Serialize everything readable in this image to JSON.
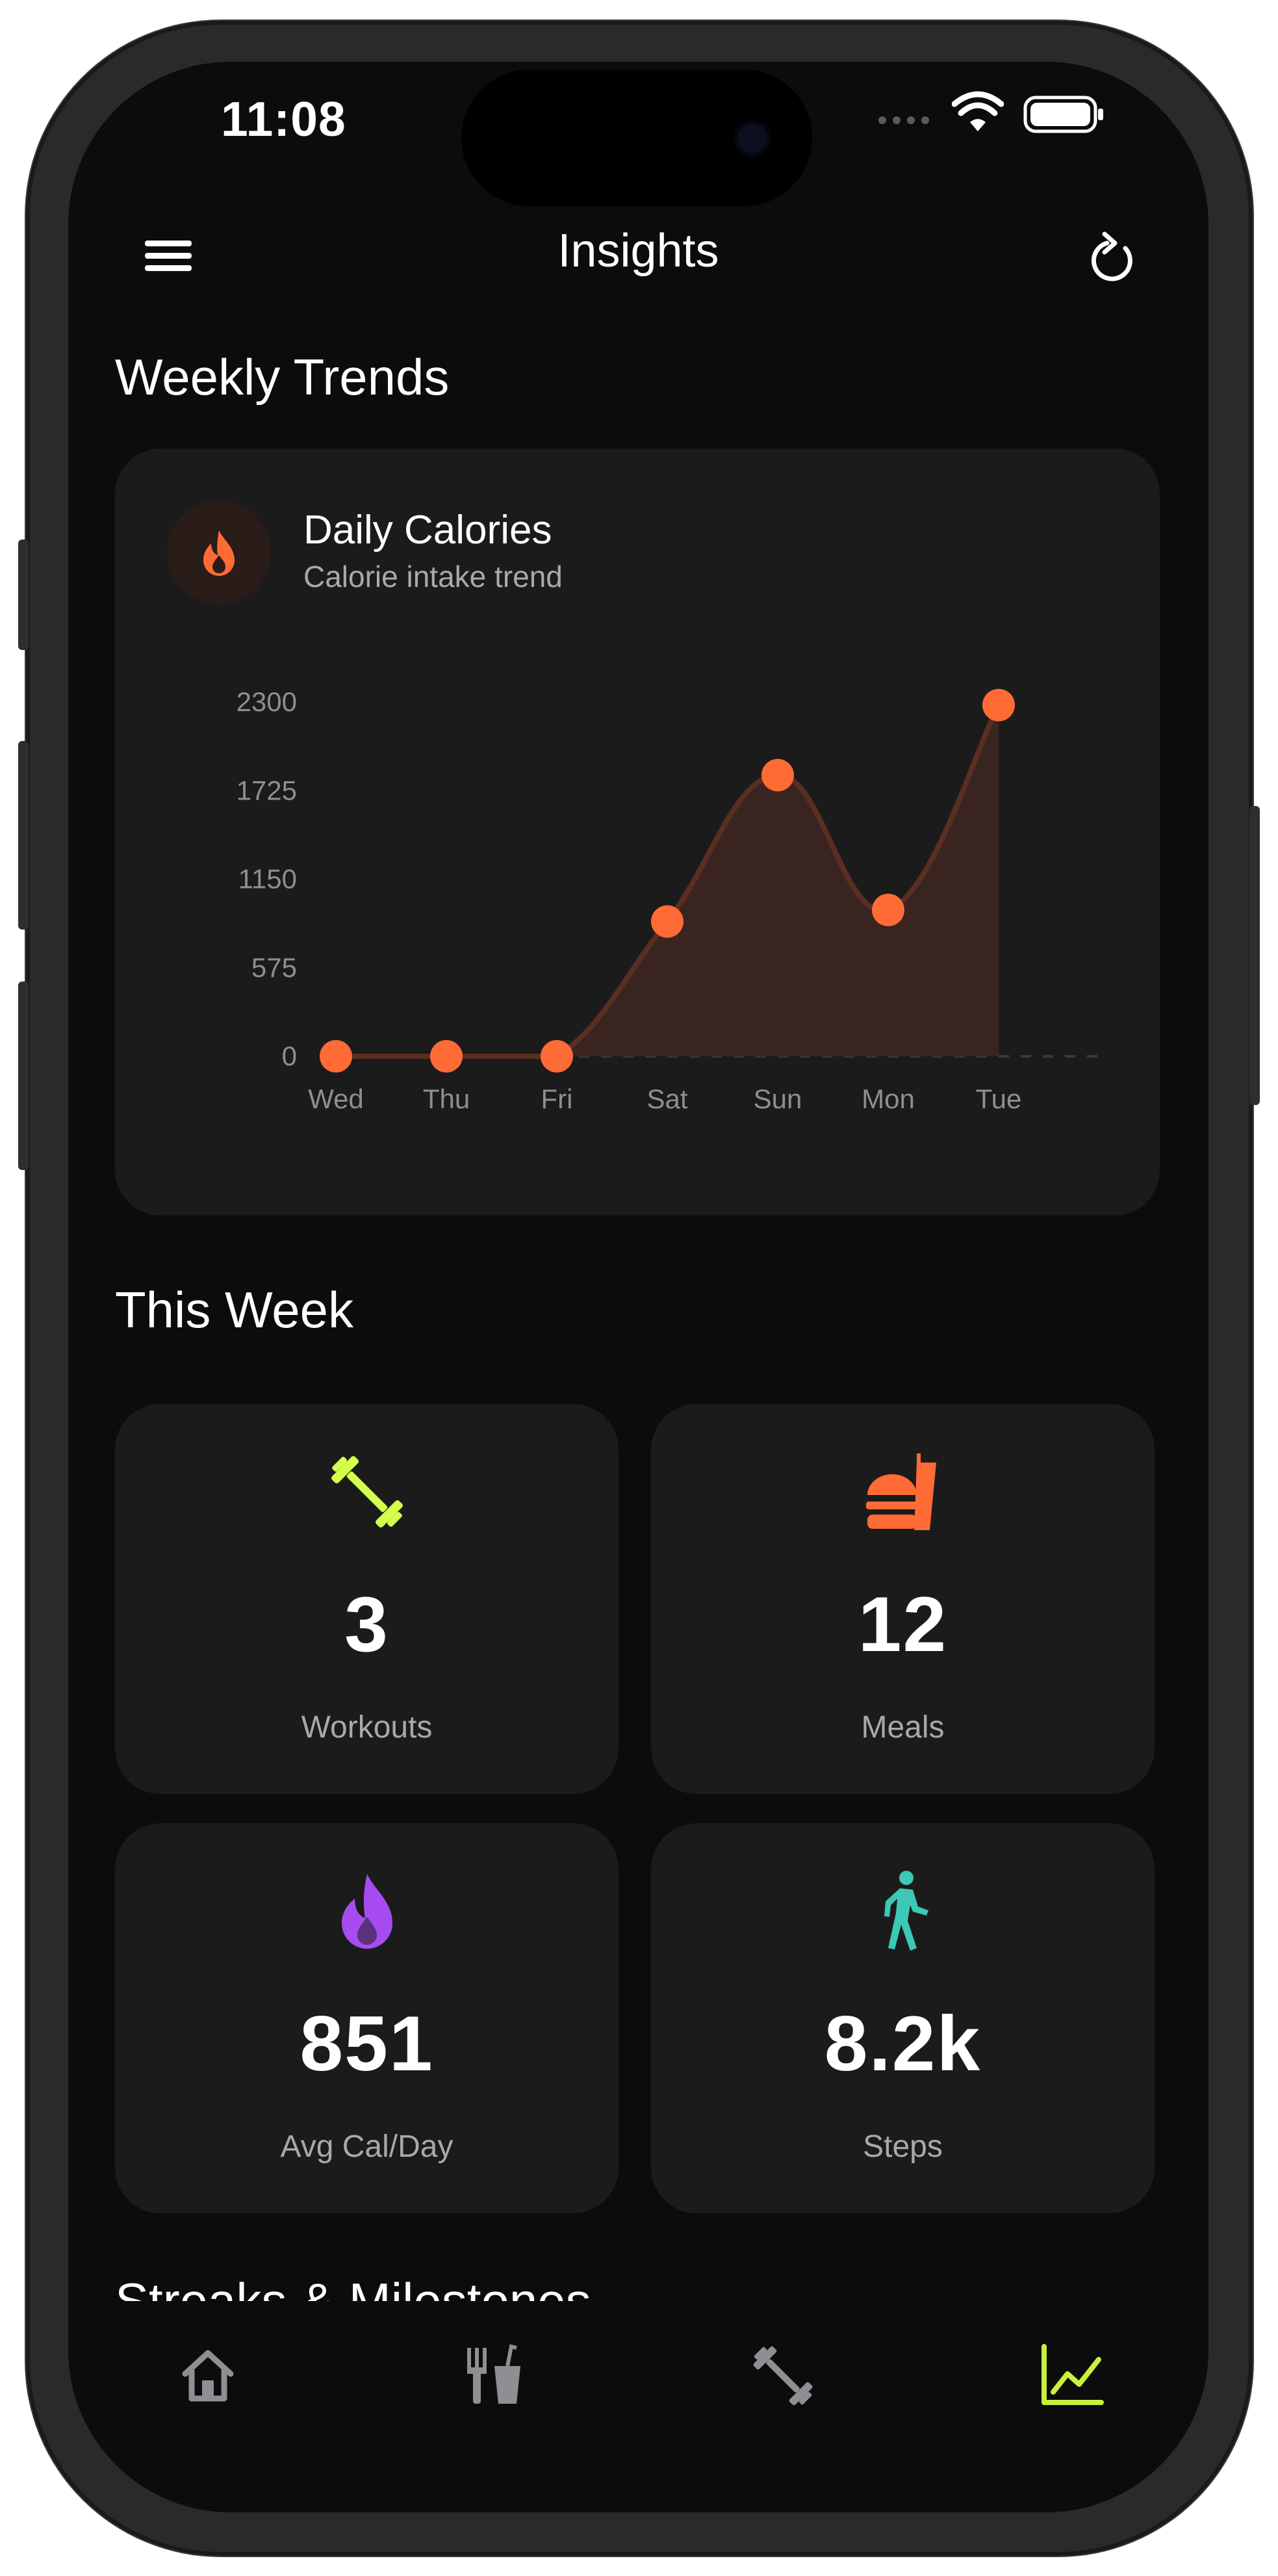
{
  "status_bar": {
    "time": "11:08"
  },
  "header": {
    "title": "Insights",
    "menu_icon": "hamburger-menu-icon",
    "refresh_icon": "refresh-icon"
  },
  "weekly_trends": {
    "section_title": "Weekly Trends",
    "card": {
      "icon": "flame-icon",
      "title": "Daily Calories",
      "subtitle": "Calorie intake trend"
    }
  },
  "chart_data": {
    "type": "area",
    "categories": [
      "Wed",
      "Thu",
      "Fri",
      "Sat",
      "Sun",
      "Mon",
      "Tue"
    ],
    "series": [
      {
        "values": [
          0,
          0,
          0,
          875,
          1825,
          950,
          2280
        ]
      }
    ],
    "yticks": [
      "2300",
      "1725",
      "1150",
      "575",
      "0"
    ],
    "ylim": [
      0,
      2300
    ],
    "grid": false,
    "colors": {
      "line": "#f26a3a",
      "fill": "#3a2420",
      "point": "#ff6b35"
    }
  },
  "this_week": {
    "section_title": "This Week",
    "stats": [
      {
        "value": "3",
        "label": "Workouts",
        "icon": "dumbbell-icon",
        "color": "#d4ff4a"
      },
      {
        "value": "12",
        "label": "Meals",
        "icon": "fast-food-icon",
        "color": "#ff6b35"
      },
      {
        "value": "851",
        "label": "Avg Cal/Day",
        "icon": "flame-icon",
        "color": "#a64cf0"
      },
      {
        "value": "8.2k",
        "label": "Steps",
        "icon": "walking-icon",
        "color": "#3cc8b4"
      }
    ]
  },
  "streaks": {
    "section_title": "Streaks & Milestones"
  },
  "tab_bar": {
    "items": [
      {
        "icon": "home-icon",
        "active": false
      },
      {
        "icon": "food-icon",
        "active": false
      },
      {
        "icon": "dumbbell-icon",
        "active": false
      },
      {
        "icon": "chart-line-icon",
        "active": true
      }
    ],
    "active_color": "#c8f03c",
    "inactive_color": "#8e8e93"
  }
}
